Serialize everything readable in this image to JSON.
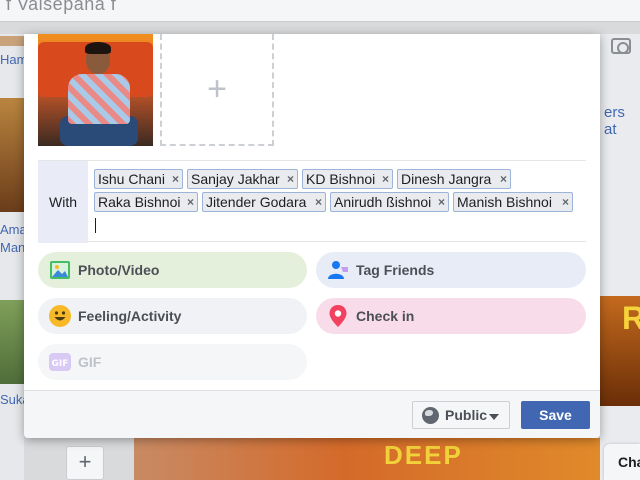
{
  "background": {
    "top_title": "f Valsepana f",
    "left_texts": [
      "Ham",
      "Ama",
      "Man",
      "Suka"
    ],
    "right_text": "ers at",
    "right_photo_text": "RA",
    "bottom_photo_text": "DEEP",
    "plus_label": "+",
    "chat_label": "Cha"
  },
  "composer": {
    "add_photo_label": "+",
    "with_label": "With",
    "tags": [
      {
        "name": "Ishu Chani",
        "remove": "×"
      },
      {
        "name": "Sanjay Jakhar",
        "remove": "×"
      },
      {
        "name": "KD Bishnoi",
        "remove": "×"
      },
      {
        "name": "Dinesh Jangra",
        "remove": "×"
      },
      {
        "name": "Raka Bishnoi",
        "remove": "×"
      },
      {
        "name": "Jitender Godara",
        "remove": "×"
      },
      {
        "name": "Anirudh ßishnoi",
        "remove": "×"
      },
      {
        "name": "Manish Bishnoi",
        "remove": "×"
      }
    ],
    "actions": {
      "photo_video": "Photo/Video",
      "tag_friends": "Tag Friends",
      "feeling_activity": "Feeling/Activity",
      "check_in": "Check in",
      "gif": "GIF"
    },
    "gif_icon_text": "GIF",
    "footer": {
      "privacy_label": "Public",
      "save_label": "Save"
    }
  },
  "colors": {
    "accent": "#4267b2",
    "photo_pill": "#e4f0dc",
    "tag_pill": "#e7ecf6",
    "checkin_pill": "#f8dcea"
  }
}
